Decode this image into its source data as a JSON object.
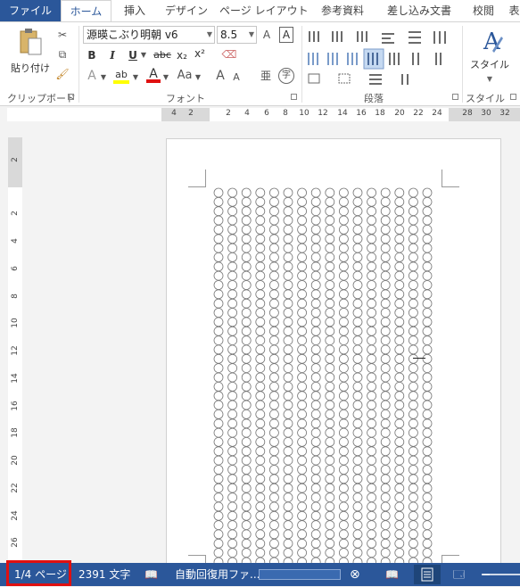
{
  "tabs": [
    {
      "label": "ファイル",
      "name": "tab-file"
    },
    {
      "label": "ホーム",
      "name": "tab-home"
    },
    {
      "label": "挿入",
      "name": "tab-insert"
    },
    {
      "label": "デザイン",
      "name": "tab-design"
    },
    {
      "label": "ページ レイアウト",
      "name": "tab-page-layout"
    },
    {
      "label": "参考資料",
      "name": "tab-references"
    },
    {
      "label": "差し込み文書",
      "name": "tab-mailings"
    },
    {
      "label": "校閲",
      "name": "tab-review"
    },
    {
      "label": "表",
      "name": "tab-view"
    }
  ],
  "clipboard": {
    "paste_label": "貼り付け",
    "group_label": "クリップボード"
  },
  "font": {
    "name_value": "源暎こぶり明朝 v6",
    "size_value": "8.5",
    "group_label": "フォント",
    "bold": "B",
    "italic": "I",
    "underline": "U",
    "strike": "abc",
    "subscript": "x₂",
    "superscript": "x²",
    "grow": "A",
    "shrink": "A",
    "change_case": "Aa",
    "clear_format": "A",
    "char_border": "A",
    "enclose": "字",
    "text_effect": "A",
    "highlight": "ab",
    "font_color": "A",
    "highlight_color": "#ffff00",
    "font_color_value": "#e01010"
  },
  "paragraph": {
    "group_label": "段落"
  },
  "styles": {
    "button_label": "スタイル",
    "group_label": "スタイル"
  },
  "hruler": {
    "numbers": [
      "4",
      "2",
      "2",
      "4",
      "6",
      "8",
      "10",
      "12",
      "14",
      "16",
      "18",
      "20",
      "22",
      "24",
      "28",
      "30",
      "32"
    ]
  },
  "vruler": {
    "numbers": [
      "2",
      "2",
      "4",
      "6",
      "8",
      "10",
      "12",
      "14",
      "16",
      "18",
      "20",
      "22",
      "24",
      "26",
      "28"
    ]
  },
  "document": {
    "grid_rows": 41,
    "grid_cols": 16
  },
  "status": {
    "page": "1/4 ページ",
    "words": "2391 文字",
    "autosave": "自動回復用ファ...",
    "accent": "#2b579a"
  }
}
